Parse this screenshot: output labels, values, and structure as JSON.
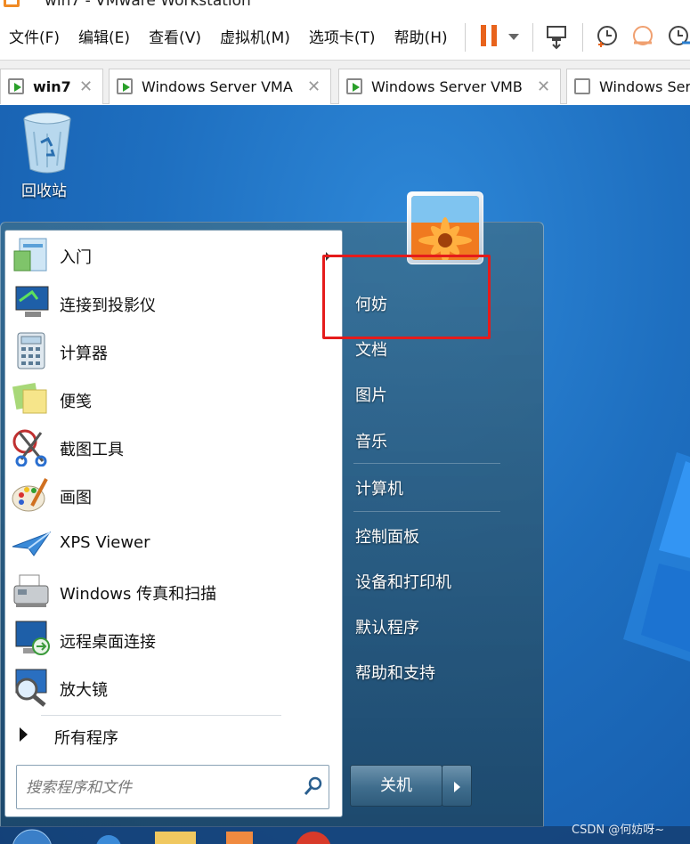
{
  "window": {
    "title": "win7 - VMware Workstation"
  },
  "menu": [
    "文件(F)",
    "编辑(E)",
    "查看(V)",
    "虚拟机(M)",
    "选项卡(T)",
    "帮助(H)"
  ],
  "tabs": [
    {
      "label": "win7",
      "active": true,
      "running": true
    },
    {
      "label": "Windows Server VMA",
      "active": false,
      "running": true
    },
    {
      "label": "Windows Server VMB",
      "active": false,
      "running": true
    },
    {
      "label": "Windows Serve",
      "active": false,
      "running": false
    }
  ],
  "desktop": {
    "recycle_bin_label": "回收站"
  },
  "start_menu": {
    "programs": [
      {
        "label": "入门",
        "icon": "getting-started-icon",
        "has_submenu": true
      },
      {
        "label": "连接到投影仪",
        "icon": "projector-icon"
      },
      {
        "label": "计算器",
        "icon": "calculator-icon"
      },
      {
        "label": "便笺",
        "icon": "sticky-notes-icon"
      },
      {
        "label": "截图工具",
        "icon": "snipping-tool-icon"
      },
      {
        "label": "画图",
        "icon": "paint-icon"
      },
      {
        "label": "XPS Viewer",
        "icon": "xps-viewer-icon"
      },
      {
        "label": "Windows 传真和扫描",
        "icon": "fax-scan-icon"
      },
      {
        "label": "远程桌面连接",
        "icon": "remote-desktop-icon"
      },
      {
        "label": "放大镜",
        "icon": "magnifier-icon"
      }
    ],
    "all_programs_label": "所有程序",
    "search_placeholder": "搜索程序和文件",
    "right_items": [
      "何妨",
      "文档",
      "图片",
      "音乐",
      "计算机",
      "控制面板",
      "设备和打印机",
      "默认程序",
      "帮助和支持"
    ],
    "shutdown_label": "关机"
  },
  "watermark": "CSDN @何妨呀~",
  "colors": {
    "highlight_box": "#e51b1b",
    "pause_icon": "#e8631c"
  }
}
